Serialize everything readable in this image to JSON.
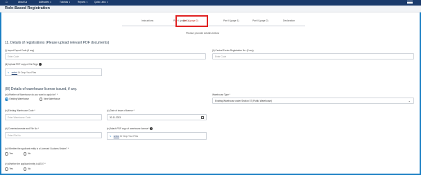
{
  "nav": {
    "items": [
      "About Us",
      "Advisories",
      "Tutorials",
      "Reports",
      "Quick Links"
    ]
  },
  "page": {
    "title": "Role-Based Registration"
  },
  "tabs": [
    {
      "label": "Instructions"
    },
    {
      "label": "Part I (page 1)"
    },
    {
      "label": "Part I (page 2)"
    },
    {
      "label": "Part II (page 1)"
    },
    {
      "label": "Part II (page 2)"
    },
    {
      "label": "Declaration"
    }
  ],
  "active_tab": "Part I (page 2)",
  "hint": "Please provide details below",
  "section1": {
    "title": "11. Details of registrations (Please upload relevant PDF documents)",
    "iec_label": "(i) Import Export Code (If any)",
    "iec_placeholder": "Enter Code",
    "cbrn_label": "(ii) Central Excise Registration No. (If any)",
    "cbrn_placeholder": "Enter Code",
    "upload_label": "(iii) Upload PDF copy of Cts Regn",
    "upload_select": "select",
    "upload_drop": "Or Drop Your Files"
  },
  "section2": {
    "title": "(III) Details of warehouse license issued, if any.",
    "type_q_label": "(a) Whether of Warehouse do you want to apply for? *",
    "type_options": [
      "Existing Warehouse",
      "New Warehouse"
    ],
    "type_selected": "Existing Warehouse",
    "wh_type_label": "Warehouse Type *",
    "wh_type_value": "Existing Warehouse under Section 57 (Public Warehouse)",
    "code_label": "(b) Existing Warehouse Code *",
    "code_placeholder": "Enter Warehouse Code",
    "date_label": "(c) Date of issue of license *",
    "date_value": "30-11-2023",
    "comm_label": "(d) Commissionerate and File No *",
    "comm_placeholder": "Enter File No",
    "attach_label": "(e) Attach PDF copy of warehouse license *",
    "attach_select": "select",
    "attach_drop": "Or Drop Your Files",
    "broker_q_label": "(iv) Whether the applicant entity is a Licensed Customs Broker? *",
    "broker_options": [
      "Yes",
      "No"
    ],
    "aeo_q_label": "(v) Whether the applicant entity is AEO? *",
    "aeo_options": [
      "Yes",
      "No"
    ]
  },
  "colors": {
    "nav_bg": "#1a3a6b",
    "accent": "#1b7fc4",
    "highlight": "#e02020"
  }
}
